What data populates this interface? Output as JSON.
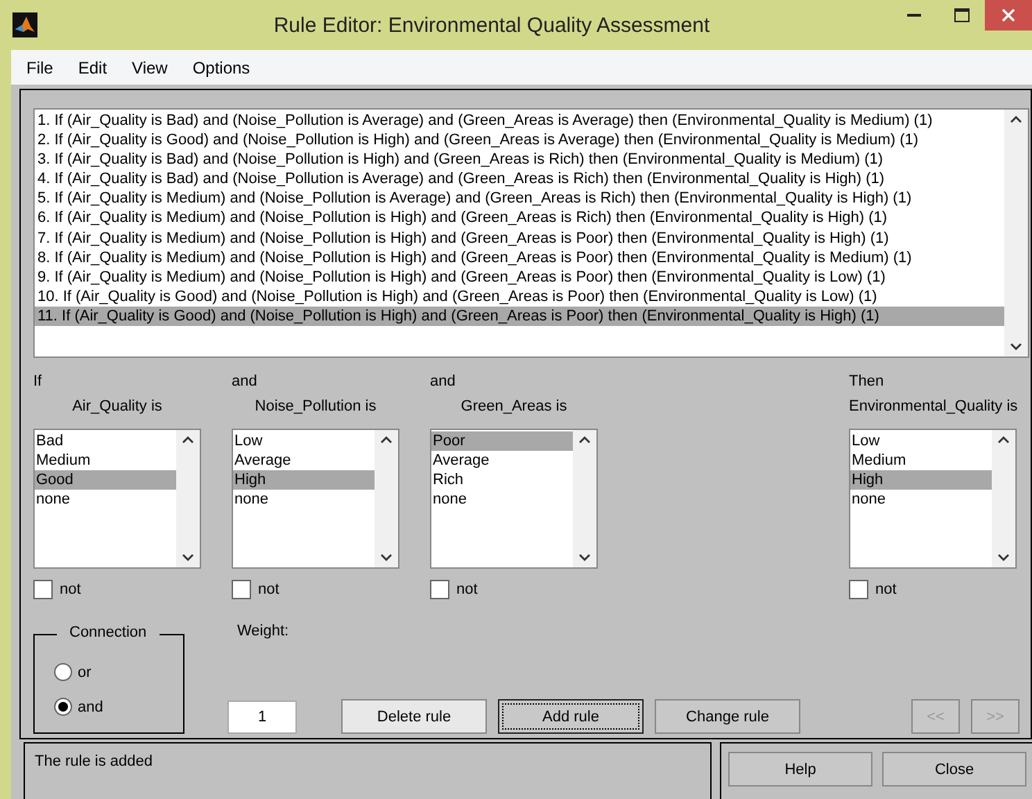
{
  "window": {
    "title": "Rule Editor: Environmental Quality Assessment"
  },
  "menu": [
    "File",
    "Edit",
    "View",
    "Options"
  ],
  "rules": [
    {
      "text": "1. If (Air_Quality is Bad) and (Noise_Pollution is Average) and (Green_Areas is Average) then (Environmental_Quality is Medium) (1)",
      "selected": false
    },
    {
      "text": "2. If (Air_Quality is Good) and (Noise_Pollution is High) and (Green_Areas is Average) then (Environmental_Quality is Medium) (1)",
      "selected": false
    },
    {
      "text": "3. If (Air_Quality is Bad) and (Noise_Pollution is High) and (Green_Areas is Rich) then (Environmental_Quality is Medium) (1)",
      "selected": false
    },
    {
      "text": "4. If (Air_Quality is Bad) and (Noise_Pollution is Average) and (Green_Areas is Rich) then (Environmental_Quality is High) (1)",
      "selected": false
    },
    {
      "text": "5. If (Air_Quality is Medium) and (Noise_Pollution is Average) and (Green_Areas is Rich) then (Environmental_Quality is High) (1)",
      "selected": false
    },
    {
      "text": "6. If (Air_Quality is Medium) and (Noise_Pollution is High) and (Green_Areas is Rich) then (Environmental_Quality is High) (1)",
      "selected": false
    },
    {
      "text": "7. If (Air_Quality is Medium) and (Noise_Pollution is High) and (Green_Areas is Poor) then (Environmental_Quality is High) (1)",
      "selected": false
    },
    {
      "text": "8. If (Air_Quality is Medium) and (Noise_Pollution is High) and (Green_Areas is Poor) then (Environmental_Quality is Medium) (1)",
      "selected": false
    },
    {
      "text": "9. If (Air_Quality is Medium) and (Noise_Pollution is High) and (Green_Areas is Poor) then (Environmental_Quality is Low) (1)",
      "selected": false
    },
    {
      "text": "10. If (Air_Quality is Good) and (Noise_Pollution is High) and (Green_Areas is Poor) then (Environmental_Quality is Low) (1)",
      "selected": false
    },
    {
      "text": "11. If (Air_Quality is Good) and (Noise_Pollution is High) and (Green_Areas is Poor) then (Environmental_Quality is High) (1)",
      "selected": true
    }
  ],
  "columns": [
    {
      "prefix": "If",
      "label": "Air_Quality is",
      "options": [
        {
          "label": "Bad",
          "selected": false
        },
        {
          "label": "Medium",
          "selected": false
        },
        {
          "label": "Good",
          "selected": true
        },
        {
          "label": "none",
          "selected": false
        }
      ],
      "not": {
        "label": "not",
        "checked": false
      }
    },
    {
      "prefix": "and",
      "label": "Noise_Pollution is",
      "options": [
        {
          "label": "Low",
          "selected": false
        },
        {
          "label": "Average",
          "selected": false
        },
        {
          "label": "High",
          "selected": true
        },
        {
          "label": "none",
          "selected": false
        }
      ],
      "not": {
        "label": "not",
        "checked": false
      }
    },
    {
      "prefix": "and",
      "label": "Green_Areas is",
      "options": [
        {
          "label": "Poor",
          "selected": true
        },
        {
          "label": "Average",
          "selected": false
        },
        {
          "label": "Rich",
          "selected": false
        },
        {
          "label": "none",
          "selected": false
        }
      ],
      "not": {
        "label": "not",
        "checked": false
      }
    },
    {
      "prefix": "Then",
      "label": "Environmental_Quality is",
      "options": [
        {
          "label": "Low",
          "selected": false
        },
        {
          "label": "Medium",
          "selected": false
        },
        {
          "label": "High",
          "selected": true
        },
        {
          "label": "none",
          "selected": false
        }
      ],
      "not": {
        "label": "not",
        "checked": false
      }
    }
  ],
  "connection": {
    "title": "Connection",
    "options": [
      {
        "label": "or",
        "selected": false
      },
      {
        "label": "and",
        "selected": true
      }
    ]
  },
  "weight": {
    "label": "Weight:",
    "value": "1"
  },
  "buttons": [
    {
      "label": "Delete rule",
      "focused": false
    },
    {
      "label": "Add rule",
      "focused": true
    },
    {
      "label": "Change rule",
      "focused": false
    }
  ],
  "nav": [
    {
      "label": "<<",
      "disabled": true
    },
    {
      "label": ">>",
      "disabled": true
    }
  ],
  "status": "The rule is added",
  "footer_buttons": [
    "Help",
    "Close"
  ]
}
